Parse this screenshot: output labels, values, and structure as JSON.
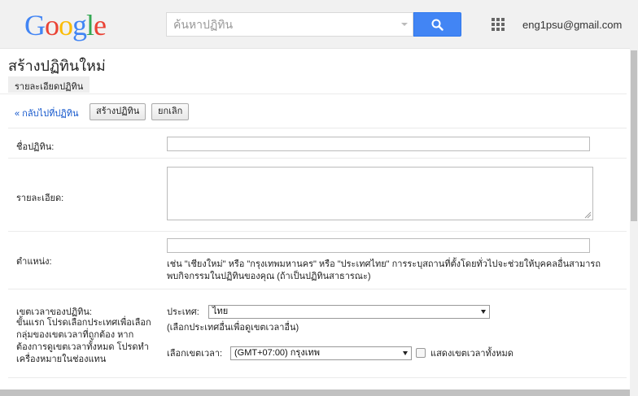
{
  "header": {
    "logo_letters": [
      {
        "char": "G",
        "color": "#4285f4"
      },
      {
        "char": "o",
        "color": "#ea4335"
      },
      {
        "char": "o",
        "color": "#fbbc05"
      },
      {
        "char": "g",
        "color": "#4285f4"
      },
      {
        "char": "l",
        "color": "#34a853"
      },
      {
        "char": "e",
        "color": "#ea4335"
      }
    ],
    "search_placeholder": "ค้นหาปฏิทิน",
    "search_icon": "search-icon",
    "apps_icon": "apps-grid-icon",
    "account_email": "eng1psu@gmail.com",
    "accent_color": "#4285f4"
  },
  "page": {
    "title": "สร้างปฏิทินใหม่",
    "tab_label": "รายละเอียดปฏิทิน"
  },
  "toolbar": {
    "back_link": "« กลับไปที่ปฏิทิน",
    "create_button": "สร้างปฏิทิน",
    "cancel_button": "ยกเลิก"
  },
  "form": {
    "name_label": "ชื่อปฏิทิน:",
    "name_value": "",
    "description_label": "รายละเอียด:",
    "description_value": "",
    "location_label": "ตำแหน่ง:",
    "location_value": "",
    "location_help_line1": "เช่น \"เชียงใหม่\" หรือ \"กรุงเทพมหานคร\" หรือ \"ประเทศไทย\" การระบุสถานที่ตั้งโดยทั่วไปจะช่วยให้บุคคลอื่นสามารถ",
    "location_help_line2": "พบกิจกรรมในปฏิทินของคุณ (ถ้าเป็นปฏิทินสาธารณะ)",
    "timezone_label": "เขตเวลาของปฏิทิน:",
    "timezone_hint": "ขั้นแรก โปรดเลือกประเทศเพื่อเลือกกลุ่มของเขตเวลาที่ถูกต้อง หากต้องการดูเขตเวลาทั้งหมด โปรดทำเครื่องหมายในช่องแทน",
    "country_label": "ประเทศ:",
    "country_value": "ไทย",
    "country_help": "(เลือกประเทศอื่นเพื่อดูเขตเวลาอื่น)",
    "timezone_select_label": "เลือกเขตเวลา:",
    "timezone_value": "(GMT+07:00) กรุงเทพ",
    "show_all_label": "แสดงเขตเวลาทั้งหมด",
    "show_all_checked": false
  }
}
